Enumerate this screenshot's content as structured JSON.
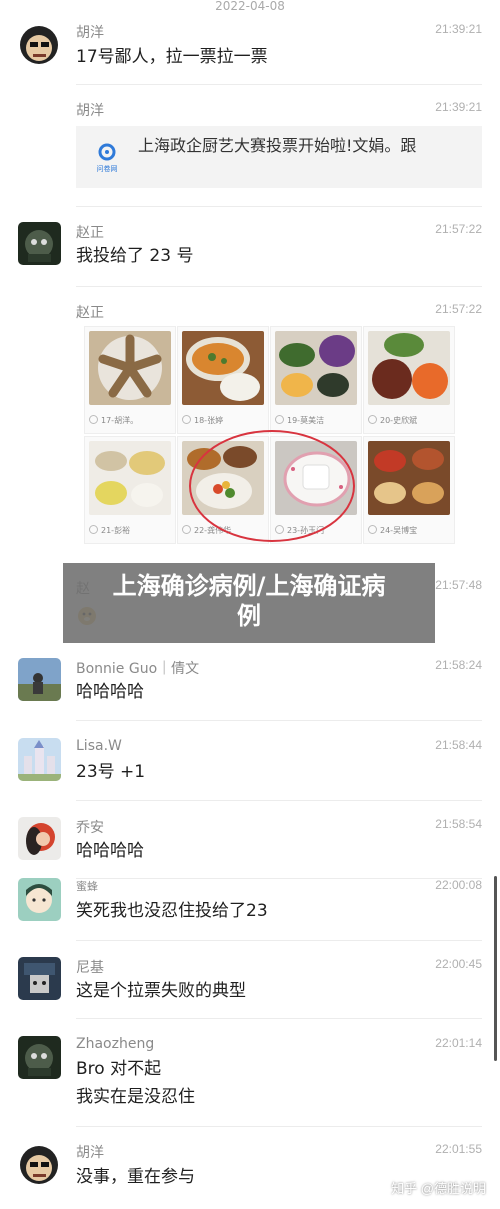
{
  "date_label": "2022-04-08",
  "messages": [
    {
      "name": "胡洋",
      "time": "21:39:21",
      "text": "17号鄙人，拉一票拉一票"
    },
    {
      "name": "胡洋",
      "time": "21:39:21",
      "card_text": "上海政企厨艺大赛投票开始啦!文娟。跟",
      "card_logo_label": "问卷网"
    },
    {
      "name": "赵正",
      "time": "21:57:22",
      "text": "我投给了 23 号"
    },
    {
      "name": "赵正",
      "time": "21:57:22",
      "grid": [
        {
          "label": "17-胡洋。"
        },
        {
          "label": "18-张婷"
        },
        {
          "label": "19-莫美洁"
        },
        {
          "label": "20-史欣斌"
        },
        {
          "label": "21-彭裕"
        },
        {
          "label": "22-龚伟华"
        },
        {
          "label": "23-孙玉门"
        },
        {
          "label": "24-吴博宝"
        }
      ]
    },
    {
      "name": "赵",
      "time": "21:57:48"
    },
    {
      "name": "Bonnie Guo｜倩文",
      "time": "21:58:24",
      "text": "哈哈哈哈"
    },
    {
      "name": "Lisa.W",
      "time": "21:58:44",
      "text": "23号 +1"
    },
    {
      "name": "乔安",
      "time": "21:58:54",
      "text": "哈哈哈哈"
    },
    {
      "name": "蜜蜂",
      "time": "22:00:08",
      "text": "笑死我也没忍住投给了23"
    },
    {
      "name": "尼基",
      "time": "22:00:45",
      "text": "这是个拉票失败的典型"
    },
    {
      "name": "Zhaozheng",
      "time": "22:01:14",
      "text": "Bro 对不起",
      "text2": "我实在是没忍住"
    },
    {
      "name": "胡洋",
      "time": "22:01:55",
      "text": "没事，重在参与"
    }
  ],
  "banner": {
    "line1": "上海确诊病例/上海确证病",
    "line2": "例"
  },
  "watermark": "知乎 @德胜说明",
  "colors": {
    "name": "#8a8a8a",
    "time": "#b0b0b0",
    "divider": "#ececec",
    "highlight_circle": "#d8343f",
    "banner_bg": "#6e6e6e"
  }
}
